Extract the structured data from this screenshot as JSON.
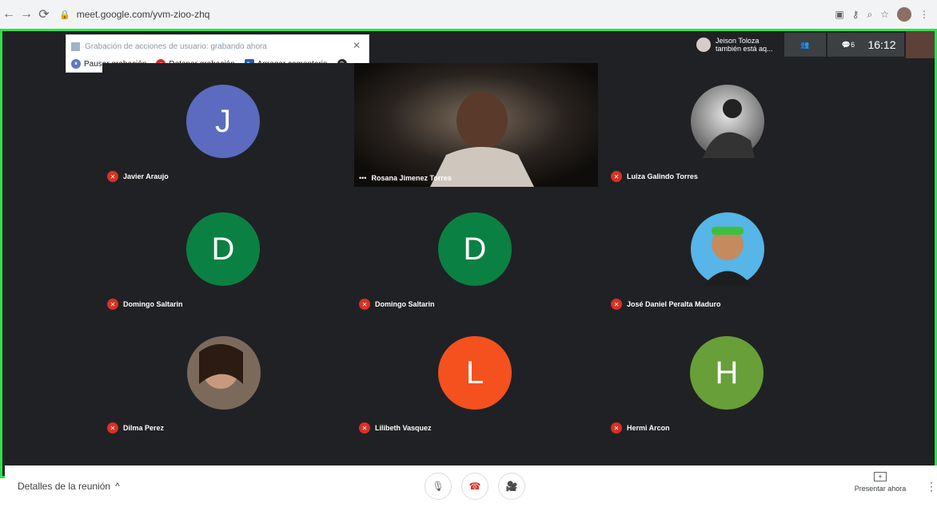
{
  "browser": {
    "url": "meet.google.com/yvm-zioo-zhq",
    "icons": [
      "back-arrow-icon",
      "forward-arrow-icon",
      "reload-icon",
      "lock-icon",
      "camera-icon",
      "key-icon",
      "zoom-icon",
      "star-icon",
      "profile-icon",
      "kebab-icon"
    ]
  },
  "topbar": {
    "joined_note_line1": "Jeison Toloza",
    "joined_note_line2": "también está aq...",
    "people_badge": "6",
    "clock": "16:12"
  },
  "recorder": {
    "title": "Grabación de acciones de usuario: grabando ahora",
    "buttons": [
      {
        "label": "Pausar grabación"
      },
      {
        "label": "Detener grabación"
      },
      {
        "label": "Agregar comentario"
      }
    ]
  },
  "participants": [
    {
      "name": "Javier Araujo",
      "initial": "J",
      "color": "#5c6bc0",
      "type": "avatar"
    },
    {
      "name": "Rosana Jimenez Torres",
      "type": "video"
    },
    {
      "name": "Luiza Galindo Torres",
      "type": "photo"
    },
    {
      "name": "Domingo Saltarin",
      "initial": "D",
      "color": "#0b8043",
      "type": "avatar"
    },
    {
      "name": "Domingo Saltarin",
      "initial": "D",
      "color": "#0b8043",
      "type": "avatar"
    },
    {
      "name": "José Daniel Peralta Maduro",
      "type": "photo"
    },
    {
      "name": "Dilma Perez",
      "type": "photo"
    },
    {
      "name": "Lilibeth Vasquez",
      "initial": "L",
      "color": "#f4511e",
      "type": "avatar"
    },
    {
      "name": "Hermi Arcon",
      "initial": "H",
      "color": "#689f38",
      "type": "avatar"
    }
  ],
  "bottombar": {
    "details_label": "Detalles de la reunión",
    "present_label": "Presentar ahora"
  }
}
